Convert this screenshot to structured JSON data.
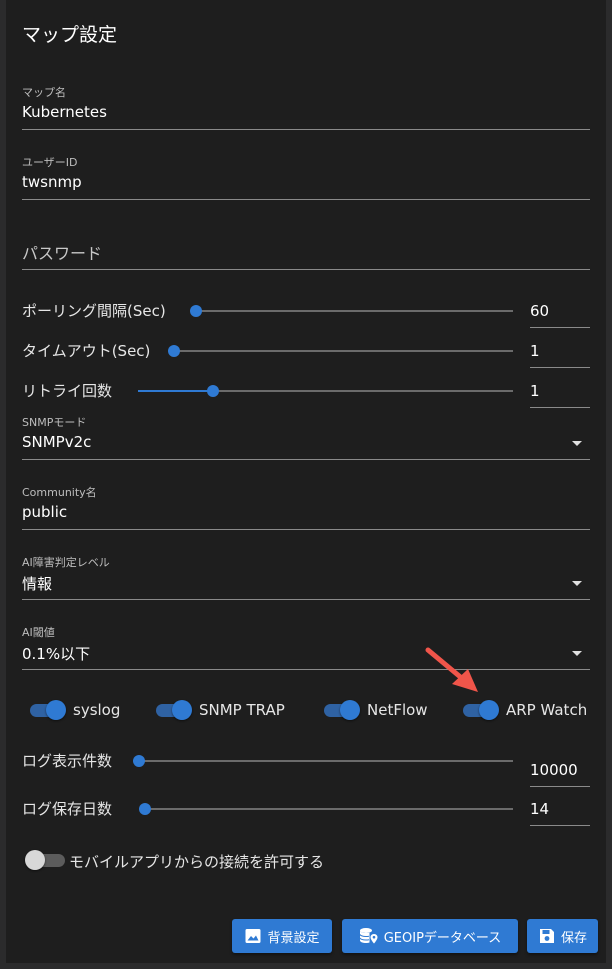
{
  "title": "マップ設定",
  "map_name": {
    "label": "マップ名",
    "value": "Kubernetes"
  },
  "user_id": {
    "label": "ユーザーID",
    "value": "twsnmp"
  },
  "password": {
    "placeholder": "パスワード",
    "value": ""
  },
  "polling_interval": {
    "label": "ポーリング間隔(Sec)",
    "value": "60"
  },
  "timeout": {
    "label": "タイムアウト(Sec)",
    "value": "1"
  },
  "retry": {
    "label": "リトライ回数",
    "value": "1"
  },
  "snmp_mode": {
    "label": "SNMPモード",
    "value": "SNMPv2c"
  },
  "community": {
    "label": "Community名",
    "value": "public"
  },
  "ai_level": {
    "label": "AI障害判定レベル",
    "value": "情報"
  },
  "ai_threshold": {
    "label": "AI閾値",
    "value": "0.1%以下"
  },
  "toggles": {
    "syslog": {
      "label": "syslog",
      "on": true
    },
    "snmp_trap": {
      "label": "SNMP TRAP",
      "on": true
    },
    "netflow": {
      "label": "NetFlow",
      "on": true
    },
    "arp_watch": {
      "label": "ARP Watch",
      "on": true
    }
  },
  "log_display_count": {
    "label": "ログ表示件数",
    "value": "10000"
  },
  "log_retention_days": {
    "label": "ログ保存日数",
    "value": "14"
  },
  "mobile_access": {
    "label": "モバイルアプリからの接続を許可する",
    "on": false
  },
  "buttons": {
    "background": "背景設定",
    "geoip": "GEOIPデータベース",
    "save": "保存"
  },
  "colors": {
    "accent": "#2f7ad3",
    "background": "#1e1e1e",
    "annotation_arrow": "#f0554a"
  }
}
